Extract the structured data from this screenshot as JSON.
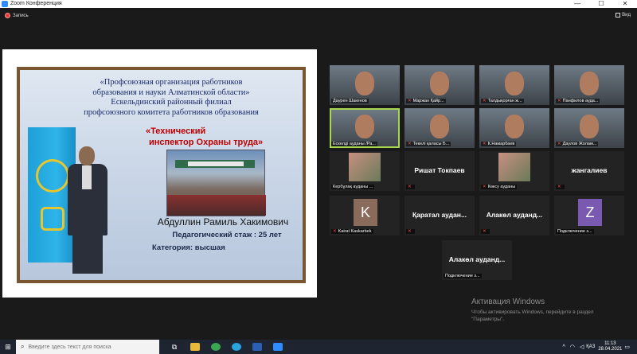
{
  "window": {
    "title": "Zoom Конференция",
    "controls": [
      "—",
      "☐",
      "✕"
    ]
  },
  "toolbar": {
    "record_label": "Запись",
    "view_label": "Вид"
  },
  "slide": {
    "title_lines": [
      "«Профсоюзная организация работников",
      "образования и науки Алматинской области»",
      "Ескельдинский районный филиал",
      "профсоюзного комитета работников образования"
    ],
    "highlight_lines": [
      "«Технический",
      "инспектор Охраны труда»"
    ],
    "name": "Абдуллин Рамиль Хакимович",
    "experience": "Педагогический стаж : 25 лет",
    "category": "Категория: высшая"
  },
  "participants": [
    {
      "name": "Даурен Шакенов",
      "muted": false,
      "type": "video"
    },
    {
      "name": "Маржан Қайр...",
      "muted": true,
      "type": "video"
    },
    {
      "name": "Талдықорған ж...",
      "muted": true,
      "type": "video"
    },
    {
      "name": "Панфилов ауда...",
      "muted": true,
      "type": "video"
    },
    {
      "name": "Ескелді ауданы /Ра...",
      "muted": false,
      "type": "video"
    },
    {
      "name": "Текелі қаласы Б...",
      "muted": true,
      "type": "video"
    },
    {
      "name": "К.Намарбаев",
      "muted": true,
      "type": "video"
    },
    {
      "name": "Даулов Жолам...",
      "muted": true,
      "type": "video"
    },
    {
      "name": "Кербұлақ ауданы ...",
      "muted": false,
      "type": "photo"
    },
    {
      "name": "Ришат Токпаев",
      "muted": true,
      "type": "text"
    },
    {
      "name": "Көксу ауданы",
      "muted": true,
      "type": "photo"
    },
    {
      "name": "жангалиев",
      "muted": true,
      "type": "text"
    },
    {
      "name": "Kairat Kaskarbek",
      "muted": true,
      "type": "letter",
      "letter": "K",
      "color": "#8a6a5a"
    },
    {
      "name": "Қаратал аудан...",
      "muted": true,
      "type": "text"
    },
    {
      "name": "Алакөл ауданд...",
      "muted": true,
      "type": "text"
    },
    {
      "name": "Подключение з...",
      "muted": false,
      "type": "letter",
      "letter": "Z",
      "color": "#7a5ab0"
    },
    {
      "name": "Алакөл ауданд...",
      "muted": false,
      "type": "text",
      "sub": "Подключение з..."
    }
  ],
  "watermark": {
    "title": "Активация Windows",
    "text": "Чтобы активировать Windows, перейдите в раздел \"Параметры\"."
  },
  "taskbar": {
    "search_placeholder": "Введите здесь текст для поиска",
    "lang": "ҚАЗ",
    "time": "11:13",
    "date": "28.04.2021"
  }
}
